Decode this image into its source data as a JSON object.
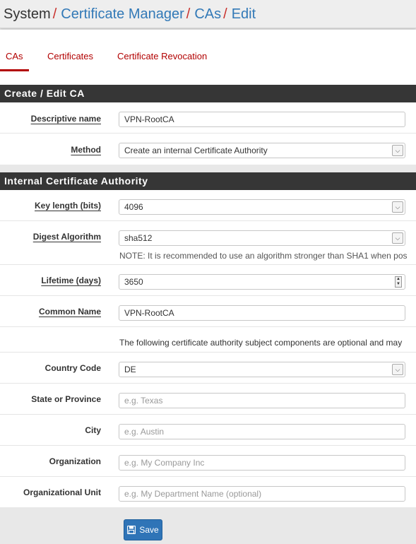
{
  "breadcrumb": {
    "root": "System",
    "separator": "/",
    "items": [
      "Certificate Manager",
      "CAs",
      "Edit"
    ]
  },
  "tabs": [
    {
      "label": "CAs",
      "active": true
    },
    {
      "label": "Certificates",
      "active": false
    },
    {
      "label": "Certificate Revocation",
      "active": false
    }
  ],
  "section1": {
    "title": "Create / Edit CA",
    "descriptive_name": {
      "label": "Descriptive name",
      "value": "VPN-RootCA"
    },
    "method": {
      "label": "Method",
      "value": "Create an internal Certificate Authority"
    }
  },
  "section2": {
    "title": "Internal Certificate Authority",
    "key_length": {
      "label": "Key length (bits)",
      "value": "4096"
    },
    "digest": {
      "label": "Digest Algorithm",
      "value": "sha512",
      "help": "NOTE: It is recommended to use an algorithm stronger than SHA1 when pos"
    },
    "lifetime": {
      "label": "Lifetime (days)",
      "value": "3650"
    },
    "common_name": {
      "label": "Common Name",
      "value": "VPN-RootCA"
    },
    "subject_note": "The following certificate authority subject components are optional and may",
    "country": {
      "label": "Country Code",
      "value": "DE"
    },
    "state": {
      "label": "State or Province",
      "placeholder": "e.g. Texas"
    },
    "city": {
      "label": "City",
      "placeholder": "e.g. Austin"
    },
    "org": {
      "label": "Organization",
      "placeholder": "e.g. My Company Inc"
    },
    "org_unit": {
      "label": "Organizational Unit",
      "placeholder": "e.g. My Department Name (optional)"
    }
  },
  "save_label": "Save",
  "colors": {
    "accent_red": "#b20000",
    "link_blue": "#3279b7",
    "panel_heading": "#363636",
    "button_blue": "#2f74b7"
  }
}
